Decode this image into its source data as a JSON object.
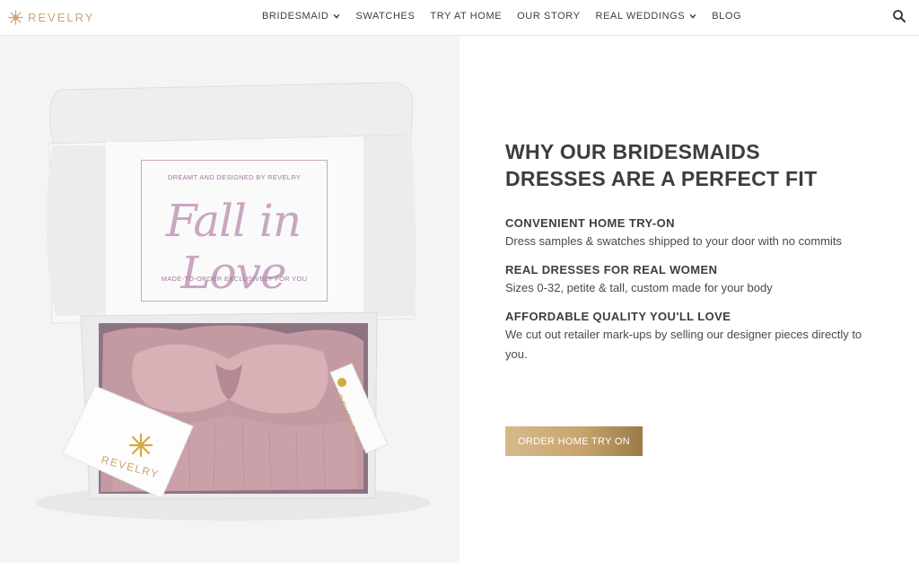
{
  "brand": {
    "name": "REVELRY",
    "logo_icon": "snowflake-logo-icon",
    "accent_color": "#c9a574"
  },
  "nav": {
    "items": [
      {
        "label": "BRIDESMAID",
        "has_dropdown": true
      },
      {
        "label": "SWATCHES",
        "has_dropdown": false
      },
      {
        "label": "TRY AT HOME",
        "has_dropdown": false
      },
      {
        "label": "OUR STORY",
        "has_dropdown": false
      },
      {
        "label": "REAL WEDDINGS",
        "has_dropdown": true
      },
      {
        "label": "BLOG",
        "has_dropdown": false
      }
    ],
    "search_icon": "search-icon"
  },
  "photo": {
    "box_line_top": "DREAMT AND DESIGNED BY REVELRY",
    "box_script": "Fall in Love",
    "box_line_bottom": "MADE-TO-ORDER EXCLUSIVELY FOR YOU",
    "card_brand": "REVELRY",
    "tag_brand": "REVELRY"
  },
  "content": {
    "headline_line1": "WHY OUR BRIDESMAIDS",
    "headline_line2": "DRESSES ARE A PERFECT FIT",
    "features": [
      {
        "title": "CONVENIENT HOME TRY-ON",
        "text": "Dress samples & swatches shipped to your door with no commits"
      },
      {
        "title": "REAL DRESSES FOR REAL WOMEN",
        "text": "Sizes 0-32, petite & tall, custom made for your body"
      },
      {
        "title": "AFFORDABLE QUALITY YOU'LL LOVE",
        "text": "We cut out retailer mark-ups by selling our designer pieces directly to you."
      }
    ],
    "cta_label": "ORDER HOME TRY ON"
  }
}
